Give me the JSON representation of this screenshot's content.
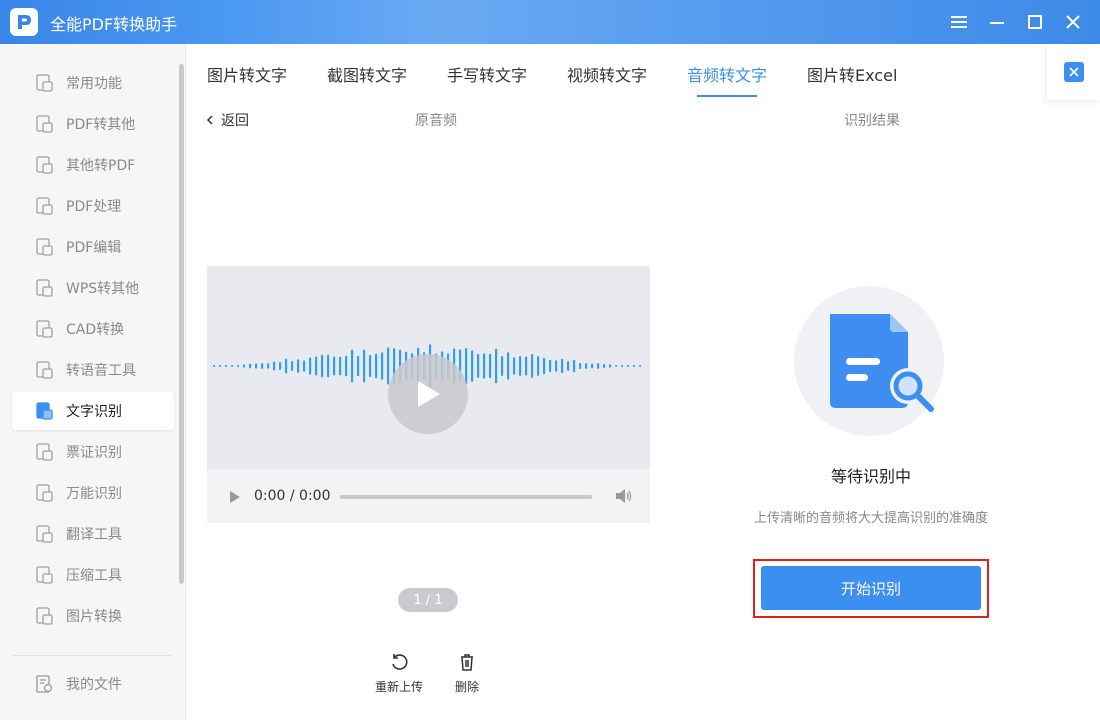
{
  "app": {
    "title": "全能PDF转换助手"
  },
  "window_controls": [
    "menu-icon",
    "minimize-icon",
    "maximize-icon",
    "close-icon"
  ],
  "sidebar": {
    "items": [
      {
        "label": "常用功能",
        "icon": "common-functions-icon",
        "active": false
      },
      {
        "label": "PDF转其他",
        "icon": "pdf-to-other-icon",
        "active": false
      },
      {
        "label": "其他转PDF",
        "icon": "other-to-pdf-icon",
        "active": false
      },
      {
        "label": "PDF处理",
        "icon": "pdf-process-icon",
        "active": false
      },
      {
        "label": "PDF编辑",
        "icon": "pdf-edit-icon",
        "active": false
      },
      {
        "label": "WPS转其他",
        "icon": "wps-convert-icon",
        "active": false
      },
      {
        "label": "CAD转换",
        "icon": "cad-convert-icon",
        "active": false
      },
      {
        "label": "转语音工具",
        "icon": "text-to-speech-icon",
        "active": false
      },
      {
        "label": "文字识别",
        "icon": "text-recognition-icon",
        "active": true
      },
      {
        "label": "票证识别",
        "icon": "ticket-recognition-icon",
        "active": false
      },
      {
        "label": "万能识别",
        "icon": "universal-recognition-icon",
        "active": false
      },
      {
        "label": "翻译工具",
        "icon": "translate-icon",
        "active": false
      },
      {
        "label": "压缩工具",
        "icon": "compress-icon",
        "active": false
      },
      {
        "label": "图片转换",
        "icon": "image-convert-icon",
        "active": false
      }
    ],
    "my_files": "我的文件"
  },
  "tabs": [
    {
      "label": "图片转文字",
      "active": false
    },
    {
      "label": "截图转文字",
      "active": false
    },
    {
      "label": "手写转文字",
      "active": false
    },
    {
      "label": "视频转文字",
      "active": false
    },
    {
      "label": "音频转文字",
      "active": true
    },
    {
      "label": "图片转Excel",
      "active": false
    }
  ],
  "main": {
    "back_label": "返回",
    "left_header": "原音频",
    "right_header": "识别结果",
    "player": {
      "time": "0:00 / 0:00"
    },
    "page_indicator": "1 / 1",
    "actions": {
      "reupload": "重新上传",
      "delete": "删除"
    },
    "result": {
      "status": "等待识别中",
      "hint": "上传清晰的音频将大大提高识别的准确度",
      "start_button": "开始识别"
    }
  },
  "colors": {
    "accent": "#3b8ff0",
    "highlight_border": "#e02020",
    "wave": "#2fa0f0"
  }
}
